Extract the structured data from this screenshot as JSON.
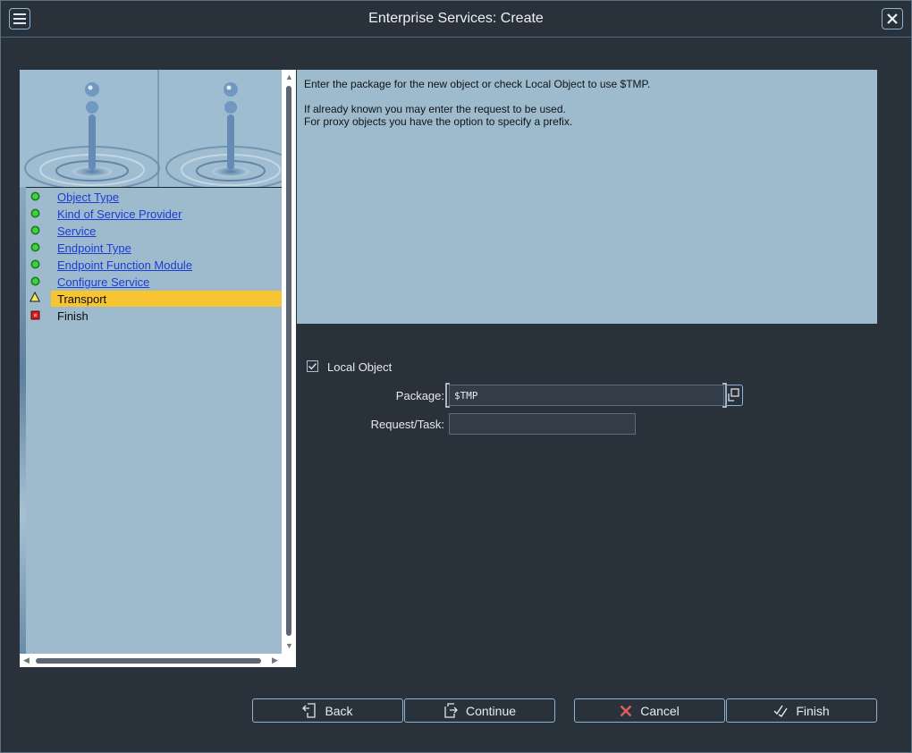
{
  "window": {
    "title": "Enterprise Services: Create"
  },
  "titlebar": {
    "menu_icon": "hamburger-menu-icon",
    "close_icon": "close-icon"
  },
  "nav": {
    "image": "water-drop-banner",
    "items": [
      {
        "label": "Object Type",
        "status": "green",
        "link": true
      },
      {
        "label": "Kind of Service Provider",
        "status": "green",
        "link": true
      },
      {
        "label": "Service",
        "status": "green",
        "link": true
      },
      {
        "label": "Endpoint Type",
        "status": "green",
        "link": true
      },
      {
        "label": "Endpoint Function Module",
        "status": "green",
        "link": true
      },
      {
        "label": "Configure Service",
        "status": "green",
        "link": true
      },
      {
        "label": "Transport",
        "status": "warning",
        "link": false,
        "active": true
      },
      {
        "label": "Finish",
        "status": "red",
        "link": false
      }
    ]
  },
  "info": {
    "line1": "Enter the package for the new object or check Local Object to use $TMP.",
    "line2": "If already known you may enter the request to be used.",
    "line3": "For proxy objects you have the option to specify a prefix."
  },
  "form": {
    "local_object": {
      "label": "Local Object",
      "checked": true
    },
    "package": {
      "label": "Package:",
      "value": "$TMP"
    },
    "request": {
      "label": "Request/Task:",
      "value": ""
    }
  },
  "footer": {
    "back": "Back",
    "continue": "Continue",
    "cancel": "Cancel",
    "finish": "Finish"
  },
  "colors": {
    "background": "#29313a",
    "panel": "#9dbbcc",
    "active_step": "#f7c531",
    "link": "#1f3bd6",
    "button_border": "#8fb3d6"
  }
}
